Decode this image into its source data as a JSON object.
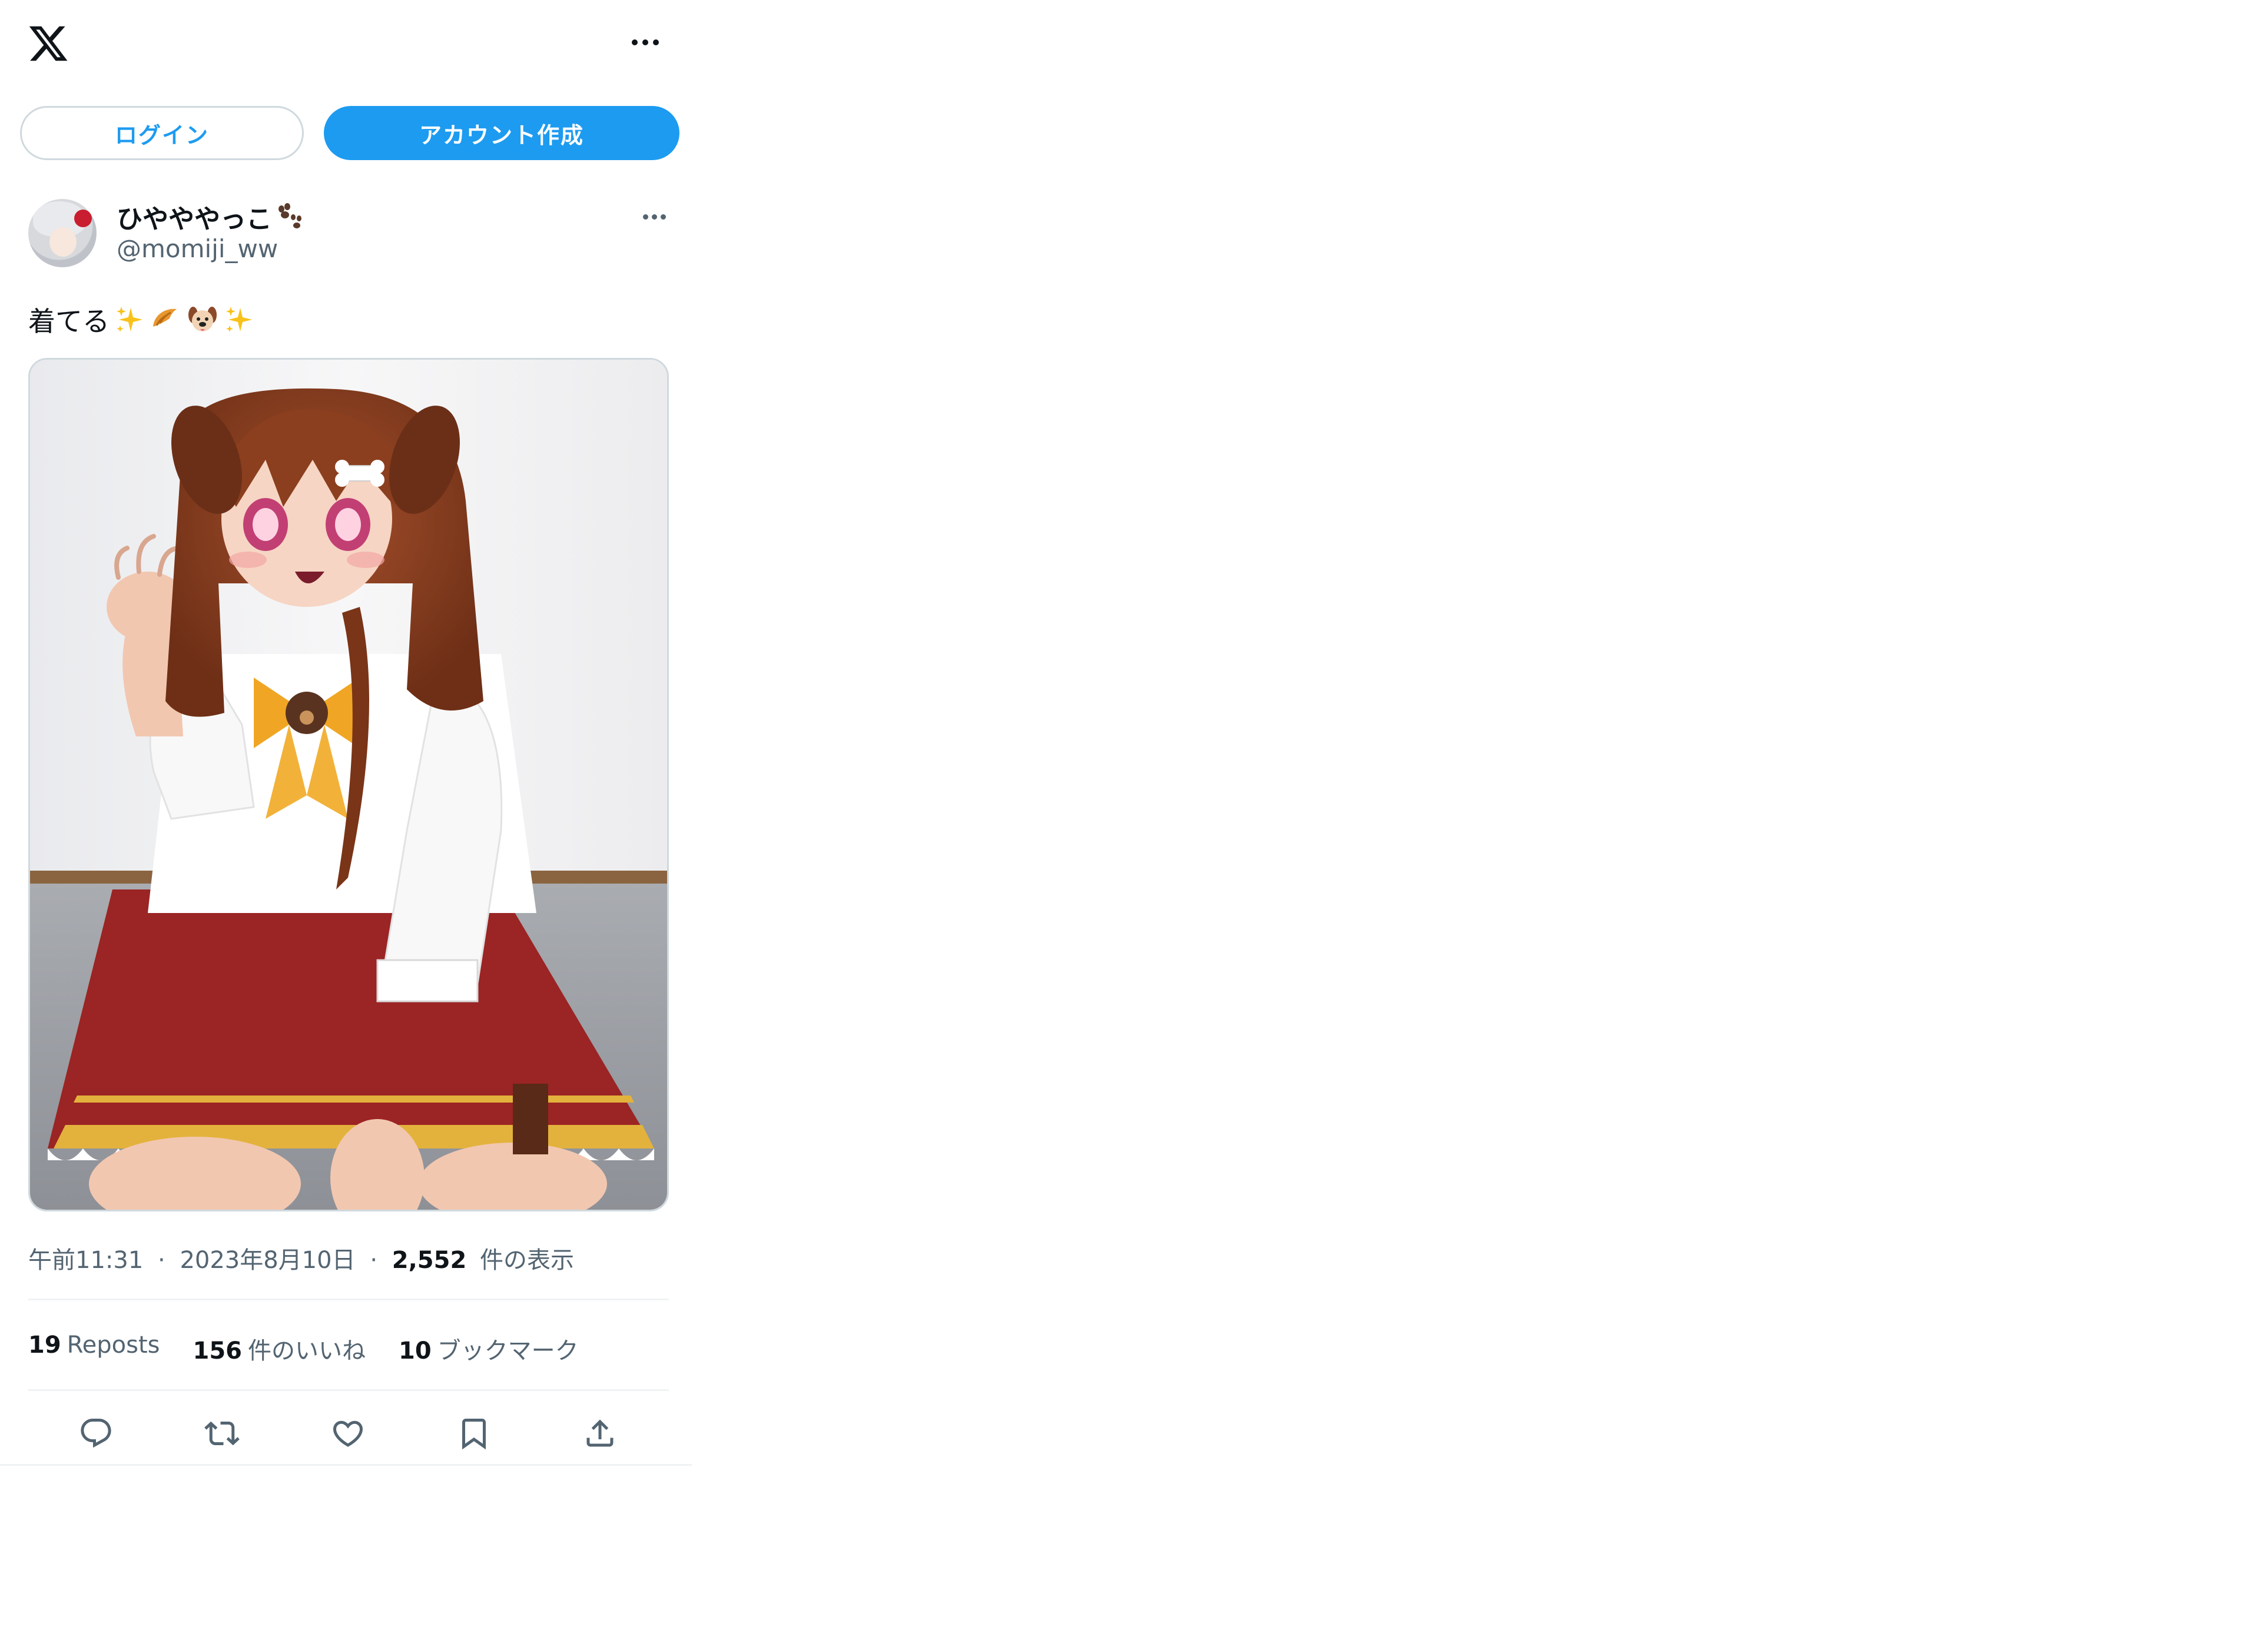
{
  "header": {
    "logo_icon": "x-logo-icon",
    "more_icon": "more-horizontal-icon"
  },
  "auth": {
    "login_label": "ログイン",
    "signup_label": "アカウント作成"
  },
  "tweet": {
    "author": {
      "display_name": "ひやややっこ",
      "name_emoji": "paw-prints-icon",
      "handle": "@momiji_ww"
    },
    "text": "着てる",
    "text_emojis": [
      "sparkles-icon",
      "croissant-icon",
      "dog-face-icon",
      "sparkles-icon"
    ],
    "media_alt": "photo",
    "time": "午前11:31",
    "date": "2023年8月10日",
    "dot_separator": "·",
    "views_count": "2,552",
    "views_label": "件の表示",
    "stats": {
      "reposts_count": "19",
      "reposts_label": "Reposts",
      "likes_count": "156",
      "likes_label": "件のいいね",
      "bookmarks_count": "10",
      "bookmarks_label": "ブックマーク"
    },
    "actions": [
      "reply-icon",
      "repost-icon",
      "like-icon",
      "bookmark-icon",
      "share-icon"
    ]
  },
  "colors": {
    "accent": "#1d9bf0",
    "text_primary": "#0f1419",
    "text_secondary": "#536471",
    "border": "#cfd9de",
    "divider": "#eff3f4"
  }
}
